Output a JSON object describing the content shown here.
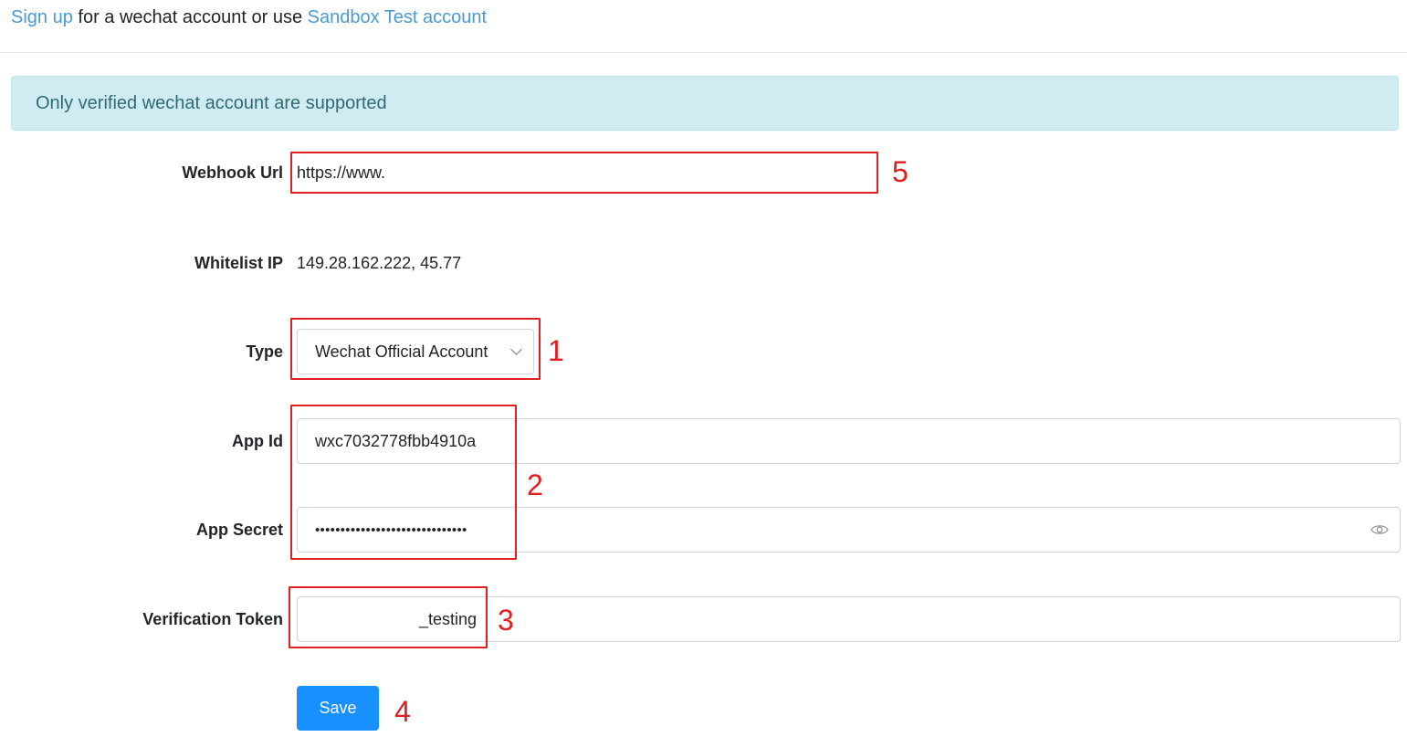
{
  "top": {
    "signup_link": "Sign up",
    "middle_text": " for a wechat account or use ",
    "sandbox_link": "Sandbox Test account"
  },
  "alert": {
    "text": "Only verified wechat account are supported"
  },
  "form": {
    "webhook": {
      "label": "Webhook Url",
      "value": "https://www."
    },
    "whitelist": {
      "label": "Whitelist IP",
      "value": "149.28.162.222, 45.77"
    },
    "type": {
      "label": "Type",
      "selected": "Wechat Official Account"
    },
    "app_id": {
      "label": "App Id",
      "value": "wxc7032778fbb4910a"
    },
    "app_secret": {
      "label": "App Secret",
      "masked_value": "••••••••••••••••••••••••••••••"
    },
    "verification_token": {
      "label": "Verification Token",
      "value": "_testing"
    },
    "save_label": "Save"
  },
  "annotations": {
    "n1": "1",
    "n2": "2",
    "n3": "3",
    "n4": "4",
    "n5": "5"
  },
  "icons": {
    "select_caret": "chevron-down-icon",
    "visibility_toggle": "eye-icon"
  },
  "colors": {
    "link": "#4a9ad4",
    "alert_bg": "#d1ecf1",
    "alert_text": "#2d6b78",
    "primary": "#1890ff",
    "annotation": "#e02020"
  }
}
